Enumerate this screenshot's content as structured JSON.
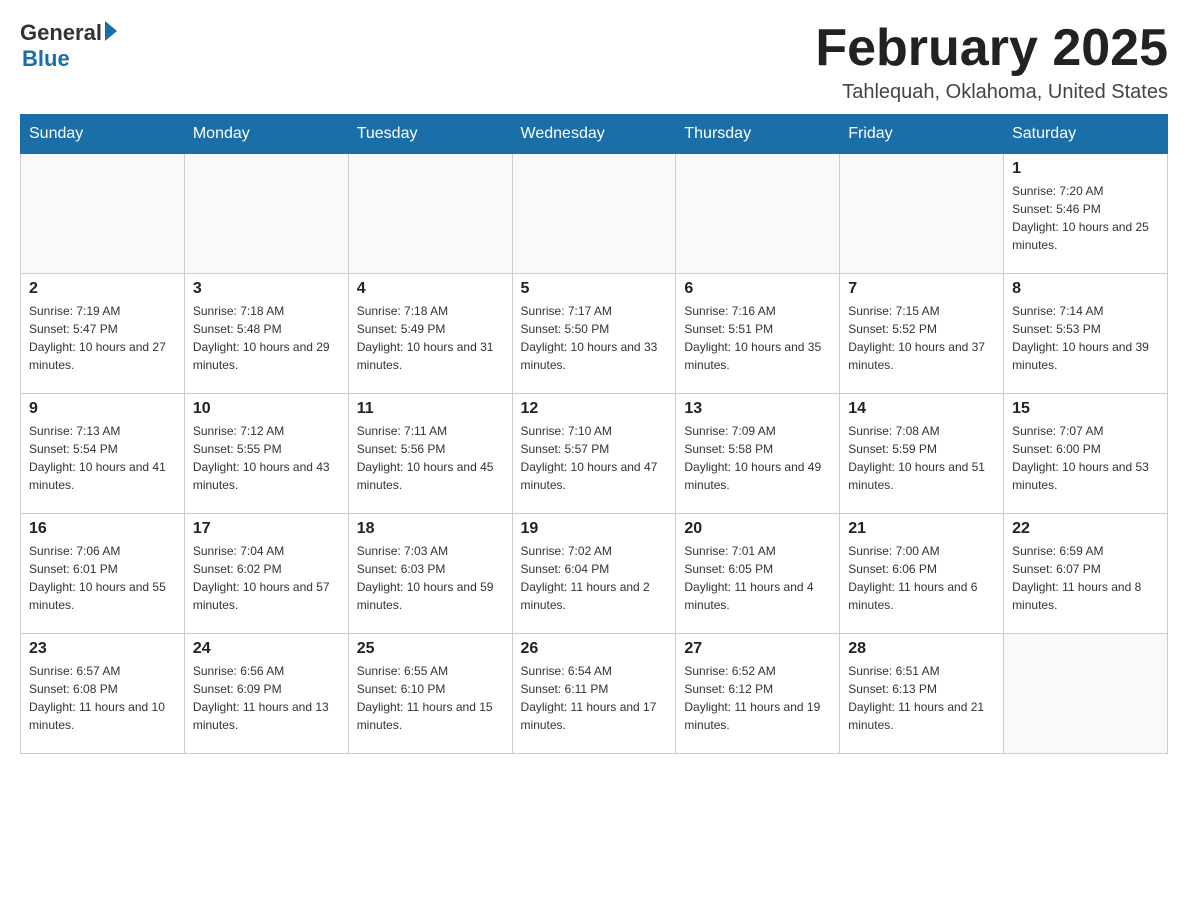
{
  "header": {
    "logo": {
      "general": "General",
      "blue": "Blue"
    },
    "title": "February 2025",
    "location": "Tahlequah, Oklahoma, United States"
  },
  "days_of_week": [
    "Sunday",
    "Monday",
    "Tuesday",
    "Wednesday",
    "Thursday",
    "Friday",
    "Saturday"
  ],
  "weeks": [
    [
      {
        "day": "",
        "info": ""
      },
      {
        "day": "",
        "info": ""
      },
      {
        "day": "",
        "info": ""
      },
      {
        "day": "",
        "info": ""
      },
      {
        "day": "",
        "info": ""
      },
      {
        "day": "",
        "info": ""
      },
      {
        "day": "1",
        "info": "Sunrise: 7:20 AM\nSunset: 5:46 PM\nDaylight: 10 hours and 25 minutes."
      }
    ],
    [
      {
        "day": "2",
        "info": "Sunrise: 7:19 AM\nSunset: 5:47 PM\nDaylight: 10 hours and 27 minutes."
      },
      {
        "day": "3",
        "info": "Sunrise: 7:18 AM\nSunset: 5:48 PM\nDaylight: 10 hours and 29 minutes."
      },
      {
        "day": "4",
        "info": "Sunrise: 7:18 AM\nSunset: 5:49 PM\nDaylight: 10 hours and 31 minutes."
      },
      {
        "day": "5",
        "info": "Sunrise: 7:17 AM\nSunset: 5:50 PM\nDaylight: 10 hours and 33 minutes."
      },
      {
        "day": "6",
        "info": "Sunrise: 7:16 AM\nSunset: 5:51 PM\nDaylight: 10 hours and 35 minutes."
      },
      {
        "day": "7",
        "info": "Sunrise: 7:15 AM\nSunset: 5:52 PM\nDaylight: 10 hours and 37 minutes."
      },
      {
        "day": "8",
        "info": "Sunrise: 7:14 AM\nSunset: 5:53 PM\nDaylight: 10 hours and 39 minutes."
      }
    ],
    [
      {
        "day": "9",
        "info": "Sunrise: 7:13 AM\nSunset: 5:54 PM\nDaylight: 10 hours and 41 minutes."
      },
      {
        "day": "10",
        "info": "Sunrise: 7:12 AM\nSunset: 5:55 PM\nDaylight: 10 hours and 43 minutes."
      },
      {
        "day": "11",
        "info": "Sunrise: 7:11 AM\nSunset: 5:56 PM\nDaylight: 10 hours and 45 minutes."
      },
      {
        "day": "12",
        "info": "Sunrise: 7:10 AM\nSunset: 5:57 PM\nDaylight: 10 hours and 47 minutes."
      },
      {
        "day": "13",
        "info": "Sunrise: 7:09 AM\nSunset: 5:58 PM\nDaylight: 10 hours and 49 minutes."
      },
      {
        "day": "14",
        "info": "Sunrise: 7:08 AM\nSunset: 5:59 PM\nDaylight: 10 hours and 51 minutes."
      },
      {
        "day": "15",
        "info": "Sunrise: 7:07 AM\nSunset: 6:00 PM\nDaylight: 10 hours and 53 minutes."
      }
    ],
    [
      {
        "day": "16",
        "info": "Sunrise: 7:06 AM\nSunset: 6:01 PM\nDaylight: 10 hours and 55 minutes."
      },
      {
        "day": "17",
        "info": "Sunrise: 7:04 AM\nSunset: 6:02 PM\nDaylight: 10 hours and 57 minutes."
      },
      {
        "day": "18",
        "info": "Sunrise: 7:03 AM\nSunset: 6:03 PM\nDaylight: 10 hours and 59 minutes."
      },
      {
        "day": "19",
        "info": "Sunrise: 7:02 AM\nSunset: 6:04 PM\nDaylight: 11 hours and 2 minutes."
      },
      {
        "day": "20",
        "info": "Sunrise: 7:01 AM\nSunset: 6:05 PM\nDaylight: 11 hours and 4 minutes."
      },
      {
        "day": "21",
        "info": "Sunrise: 7:00 AM\nSunset: 6:06 PM\nDaylight: 11 hours and 6 minutes."
      },
      {
        "day": "22",
        "info": "Sunrise: 6:59 AM\nSunset: 6:07 PM\nDaylight: 11 hours and 8 minutes."
      }
    ],
    [
      {
        "day": "23",
        "info": "Sunrise: 6:57 AM\nSunset: 6:08 PM\nDaylight: 11 hours and 10 minutes."
      },
      {
        "day": "24",
        "info": "Sunrise: 6:56 AM\nSunset: 6:09 PM\nDaylight: 11 hours and 13 minutes."
      },
      {
        "day": "25",
        "info": "Sunrise: 6:55 AM\nSunset: 6:10 PM\nDaylight: 11 hours and 15 minutes."
      },
      {
        "day": "26",
        "info": "Sunrise: 6:54 AM\nSunset: 6:11 PM\nDaylight: 11 hours and 17 minutes."
      },
      {
        "day": "27",
        "info": "Sunrise: 6:52 AM\nSunset: 6:12 PM\nDaylight: 11 hours and 19 minutes."
      },
      {
        "day": "28",
        "info": "Sunrise: 6:51 AM\nSunset: 6:13 PM\nDaylight: 11 hours and 21 minutes."
      },
      {
        "day": "",
        "info": ""
      }
    ]
  ]
}
